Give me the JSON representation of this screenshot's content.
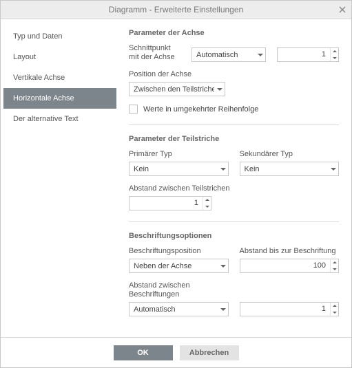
{
  "dialog": {
    "title": "Diagramm - Erweiterte Einstellungen"
  },
  "sidebar": {
    "items": [
      {
        "label": "Typ und Daten"
      },
      {
        "label": "Layout"
      },
      {
        "label": "Vertikale Achse"
      },
      {
        "label": "Horizontale Achse"
      },
      {
        "label": "Der alternative Text"
      }
    ],
    "active_index": 3
  },
  "axis_params": {
    "section_title": "Parameter der Achse",
    "cross_label": "Schnittpunkt mit der Achse",
    "cross_select": "Automatisch",
    "cross_value": "1",
    "position_label": "Position der Achse",
    "position_select": "Zwischen den Teilstrichen",
    "reverse_label": "Werte in umgekehrter Reihenfolge"
  },
  "tick_params": {
    "section_title": "Parameter der Teilstriche",
    "primary_label": "Primärer Typ",
    "primary_select": "Kein",
    "secondary_label": "Sekundärer Typ",
    "secondary_select": "Kein",
    "interval_label": "Abstand zwischen Teilstrichen",
    "interval_value": "1"
  },
  "label_opts": {
    "section_title": "Beschriftungsoptionen",
    "position_label": "Beschriftungsposition",
    "position_select": "Neben der Achse",
    "distance_label": "Abstand bis zur Beschriftung",
    "distance_value": "100",
    "interval_label": "Abstand zwischen Beschriftungen",
    "interval_select": "Automatisch",
    "interval_value": "1"
  },
  "footer": {
    "ok": "OK",
    "cancel": "Abbrechen"
  }
}
